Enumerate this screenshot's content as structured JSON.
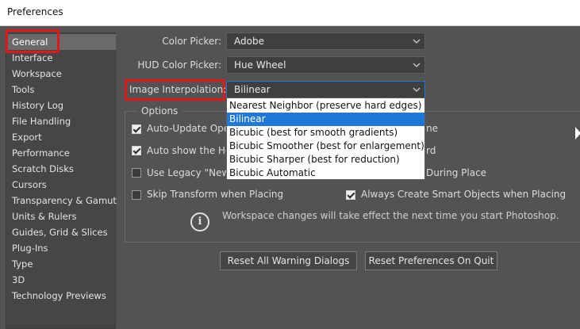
{
  "window": {
    "title": "Preferences"
  },
  "sidebar": {
    "items": [
      {
        "label": "General",
        "selected": true
      },
      {
        "label": "Interface"
      },
      {
        "label": "Workspace"
      },
      {
        "label": "Tools"
      },
      {
        "label": "History Log"
      },
      {
        "label": "File Handling"
      },
      {
        "label": "Export"
      },
      {
        "label": "Performance"
      },
      {
        "label": "Scratch Disks"
      },
      {
        "label": "Cursors"
      },
      {
        "label": "Transparency & Gamut"
      },
      {
        "label": "Units & Rulers"
      },
      {
        "label": "Guides, Grid & Slices"
      },
      {
        "label": "Plug-Ins"
      },
      {
        "label": "Type"
      },
      {
        "label": "3D"
      },
      {
        "label": "Technology Previews"
      }
    ]
  },
  "fields": {
    "color_picker": {
      "label": "Color Picker:",
      "value": "Adobe"
    },
    "hud_color_picker": {
      "label": "HUD Color Picker:",
      "value": "Hue Wheel"
    },
    "image_interpolation": {
      "label": "Image Interpolation:",
      "value": "Bilinear",
      "options": [
        "Nearest Neighbor (preserve hard edges)",
        "Bilinear",
        "Bicubic (best for smooth gradients)",
        "Bicubic Smoother (best for enlargement)",
        "Bicubic Sharper (best for reduction)",
        "Bicubic Automatic"
      ]
    }
  },
  "options": {
    "title": "Options",
    "auto_update_left": "Auto-Update Open",
    "auto_update_right": "ne",
    "auto_show_left": "Auto show the Ho",
    "auto_show_right": "rd",
    "use_legacy_left": "Use Legacy \"New",
    "use_legacy_right": "During Place",
    "skip_transform": "Skip Transform when Placing",
    "always_smart": "Always Create Smart Objects when Placing",
    "checked": {
      "auto_update": true,
      "auto_show": true,
      "use_legacy": false,
      "skip_transform": false,
      "always_smart": true
    }
  },
  "info": {
    "text": "Workspace changes will take effect the next time you start Photoshop."
  },
  "buttons": {
    "reset_warnings": "Reset All Warning Dialogs",
    "reset_prefs": "Reset Preferences On Quit"
  },
  "colors": {
    "highlight": "#1e78d7",
    "annotation_red": "#e01818"
  }
}
